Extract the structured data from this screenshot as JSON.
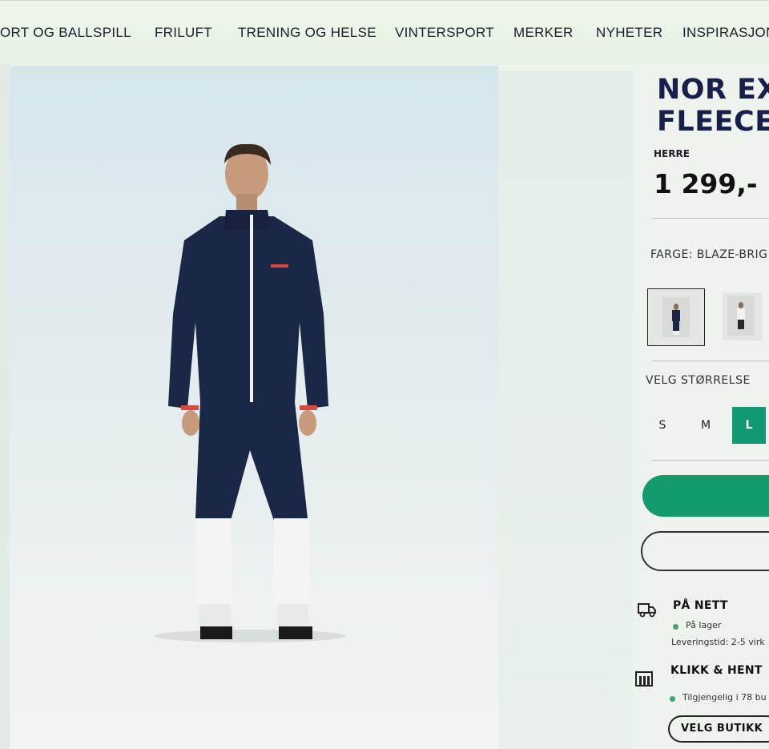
{
  "nav": {
    "items": [
      "ORT OG BALLSPILL",
      "FRILUFT",
      "TRENING OG HELSE",
      "VINTERSPORT",
      "MERKER",
      "NYHETER",
      "INSPIRASJON"
    ]
  },
  "product": {
    "title_line1": "NOR EX",
    "title_line2": "FLEECE",
    "gender": "HERRE",
    "price": "1 299,-",
    "color_label": "FARGE: BLAZE-BRIG"
  },
  "size": {
    "label": "VELG STØRRELSE",
    "options": [
      "S",
      "M",
      "L"
    ],
    "selected": "L"
  },
  "delivery": {
    "online_title": "PÅ NETT",
    "online_status": "På lager",
    "online_time": "Leveringstid: 2-5 virk",
    "pickup_title": "KLIKK & HENT",
    "pickup_status": "Tilgjengelig i 78 bu",
    "store_button": "VELG BUTIKK"
  },
  "colors": {
    "accent": "#139a70",
    "title": "#17204a"
  },
  "icons": {
    "delivery": "truck-icon",
    "pickup": "store-icon"
  }
}
